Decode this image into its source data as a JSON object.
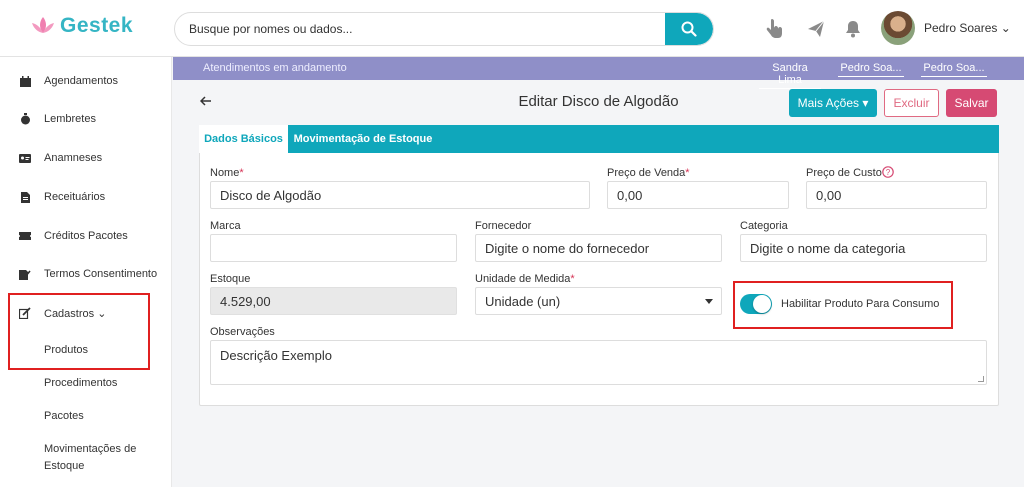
{
  "header": {
    "logo_text": "Gestek",
    "search_placeholder": "Busque por nomes ou dados...",
    "user_name": "Pedro Soares ⌄"
  },
  "sidebar": {
    "items": [
      {
        "label": "Agendamentos",
        "icon": "calendar-icon"
      },
      {
        "label": "Lembretes",
        "icon": "stopwatch-icon"
      },
      {
        "label": "Anamneses",
        "icon": "id-card-icon"
      },
      {
        "label": "Receituários",
        "icon": "document-icon"
      },
      {
        "label": "Créditos Pacotes",
        "icon": "ticket-icon"
      },
      {
        "label": "Termos Consentimento",
        "icon": "signature-icon"
      },
      {
        "label": "Cadastros ⌄",
        "icon": "edit-icon"
      }
    ],
    "subitems": [
      "Produtos",
      "Procedimentos",
      "Pacotes",
      "Movimentações de",
      "Estoque"
    ]
  },
  "ongoing": {
    "label": "Atendimentos em andamento",
    "tabs": [
      "Sandra Lima",
      "Pedro Soa...",
      "Pedro Soa..."
    ]
  },
  "page": {
    "title": "Editar Disco de Algodão",
    "more_actions": "Mais Ações ▾",
    "delete": "Excluir",
    "save": "Salvar"
  },
  "tabs": [
    "Dados Básicos",
    "Movimentação de Estoque"
  ],
  "form": {
    "nome_label": "Nome",
    "nome_value": "Disco de Algodão",
    "preco_venda_label": "Preço de Venda",
    "preco_venda_value": "0,00",
    "preco_custo_label": "Preço de Custo",
    "preco_custo_value": "0,00",
    "marca_label": "Marca",
    "marca_value": "",
    "fornecedor_label": "Fornecedor",
    "fornecedor_placeholder": "Digite o nome do fornecedor",
    "categoria_label": "Categoria",
    "categoria_placeholder": "Digite o nome da categoria",
    "estoque_label": "Estoque",
    "estoque_value": "4.529,00",
    "unidade_label": "Unidade de Medida",
    "unidade_value": "Unidade (un)",
    "toggle_label": "Habilitar Produto Para Consumo",
    "toggle_on": true,
    "observacoes_label": "Observações",
    "observacoes_value": "Descrição Exemplo",
    "required_mark": "*"
  },
  "colors": {
    "accent": "#0fa7bb",
    "danger": "#d64a73",
    "purple_bar": "#8f8fc8",
    "highlight": "#e02020"
  }
}
